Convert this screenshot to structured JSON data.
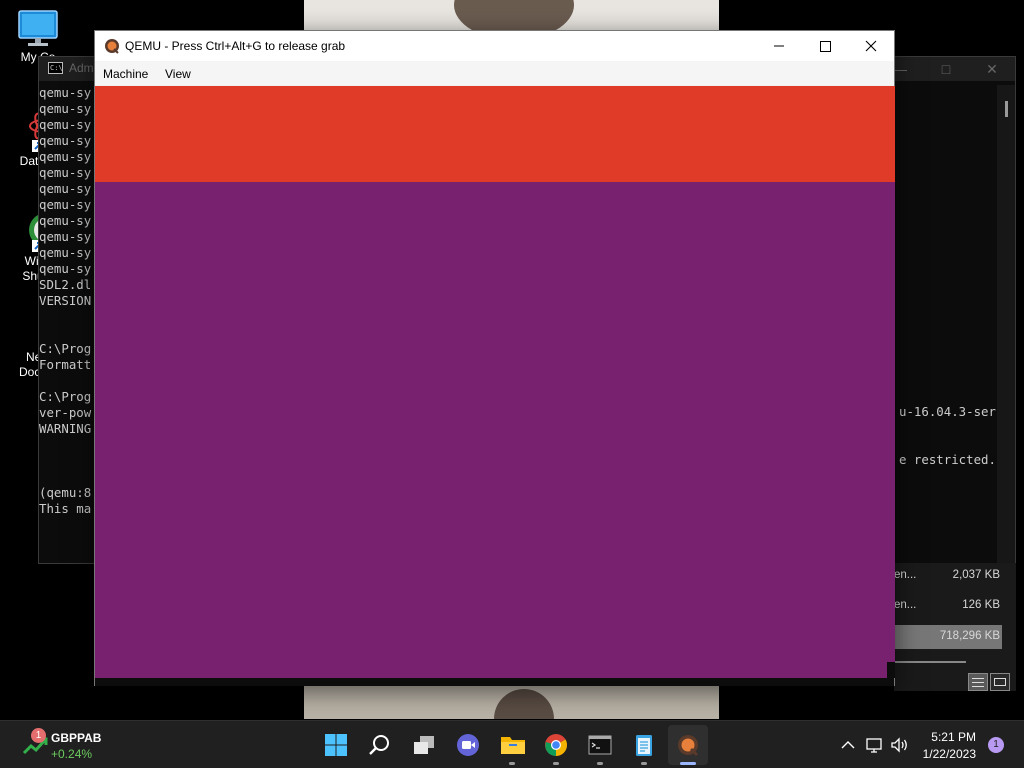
{
  "desktop": {
    "icons": [
      {
        "label": "My Co",
        "label2": ""
      },
      {
        "label": "DataW",
        "label2": ""
      },
      {
        "label": "Wise",
        "label2": "Shutd"
      },
      {
        "label": "New",
        "label2": "Docum"
      }
    ]
  },
  "cmd": {
    "title": "Adm",
    "lines": [
      "qemu-sy",
      "qemu-sy",
      "qemu-sy",
      "qemu-sy",
      "qemu-sy",
      "qemu-sy",
      "qemu-sy",
      "qemu-sy",
      "qemu-sy",
      "qemu-sy",
      "qemu-sy",
      "qemu-sy",
      "SDL2.dl",
      "VERSION",
      "",
      "",
      "C:\\Prog",
      "Formatt",
      "",
      "C:\\Prog",
      "ver-pow",
      "WARNING",
      "",
      "",
      "",
      "(qemu:8",
      "This ma"
    ],
    "right_line_1": "u-16.04.3-ser",
    "right_line_2": "e restricted."
  },
  "files": {
    "rows": [
      {
        "name": "en...",
        "size": "2,037 KB",
        "selected": false
      },
      {
        "name": "en...",
        "size": "126 KB",
        "selected": false
      },
      {
        "name": "",
        "size": "718,296 KB",
        "selected": true
      }
    ]
  },
  "qemu": {
    "title": "QEMU - Press Ctrl+Alt+G to release grab",
    "menu": [
      "Machine",
      "View"
    ],
    "screen_colors": {
      "top_band": "#e03a28",
      "background": "#77216f"
    }
  },
  "taskbar": {
    "widget": {
      "badge": "1",
      "name": "GBPPAB",
      "change": "+0.24%"
    },
    "apps": [
      "start-icon",
      "search-icon",
      "task-view-icon",
      "meet-icon",
      "file-explorer-icon",
      "chrome-icon",
      "cmd-icon",
      "notepad-icon",
      "qemu-icon"
    ],
    "time": "5:21 PM",
    "date": "1/22/2023",
    "notifications": "1"
  }
}
